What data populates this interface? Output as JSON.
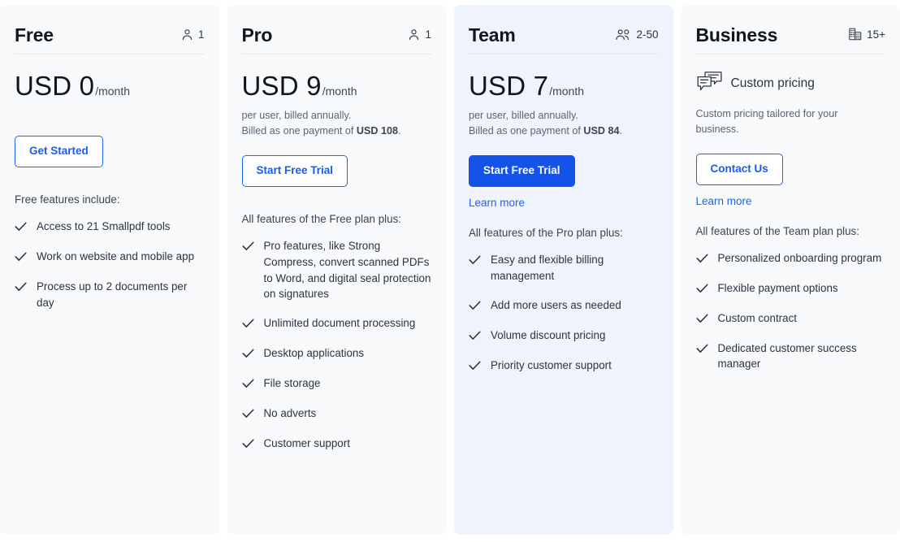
{
  "colors": {
    "card_bg": "#f8f9fb",
    "card_bg_highlight": "#eef3fd",
    "accent": "#1552e8",
    "link": "#2563eb",
    "text": "#2c3440"
  },
  "plans": [
    {
      "name": "Free",
      "seats_icon": "single-user-icon",
      "seats": "1",
      "price_main": "USD 0",
      "price_period": "/month",
      "billing_lines": [],
      "cta_label": "Get Started",
      "cta_style": "outline",
      "learn_more": null,
      "features_intro": "Free features include:",
      "features": [
        "Access to 21 Smallpdf tools",
        "Work on website and mobile app",
        "Process up to 2 documents per day"
      ]
    },
    {
      "name": "Pro",
      "seats_icon": "single-user-icon",
      "seats": "1",
      "price_main": "USD 9",
      "price_period": "/month",
      "billing_lines": [
        {
          "text": "per user, billed annually.",
          "bold": null,
          "suffix": null
        },
        {
          "text": "Billed as one payment of ",
          "bold": "USD 108",
          "suffix": "."
        }
      ],
      "cta_label": "Start Free Trial",
      "cta_style": "outline",
      "learn_more": null,
      "features_intro": "All features of the Free plan plus:",
      "features": [
        "Pro features, like Strong Compress, convert scanned PDFs to Word, and digital seal protection on signatures",
        "Unlimited document processing",
        "Desktop applications",
        "File storage",
        "No adverts",
        "Customer support"
      ]
    },
    {
      "name": "Team",
      "seats_icon": "two-users-icon",
      "seats": "2-50",
      "price_main": "USD 7",
      "price_period": "/month",
      "billing_lines": [
        {
          "text": "per user, billed annually.",
          "bold": null,
          "suffix": null
        },
        {
          "text": "Billed as one payment of ",
          "bold": "USD 84",
          "suffix": "."
        }
      ],
      "cta_label": "Start Free Trial",
      "cta_style": "filled",
      "learn_more": "Learn more",
      "features_intro": "All features of the Pro plan plus:",
      "features": [
        "Easy and flexible billing management",
        "Add more users as needed",
        "Volume discount pricing",
        "Priority customer support"
      ]
    },
    {
      "name": "Business",
      "seats_icon": "building-icon",
      "seats": "15+",
      "custom_pricing_icon": "speech-bubbles-icon",
      "custom_pricing_label": "Custom pricing",
      "custom_pricing_desc": "Custom pricing tailored for your business.",
      "cta_label": "Contact Us",
      "cta_style": "outline",
      "learn_more": "Learn more",
      "features_intro": "All features of the Team plan plus:",
      "features": [
        "Personalized onboarding program",
        "Flexible payment options",
        "Custom contract",
        "Dedicated customer success manager"
      ]
    }
  ]
}
